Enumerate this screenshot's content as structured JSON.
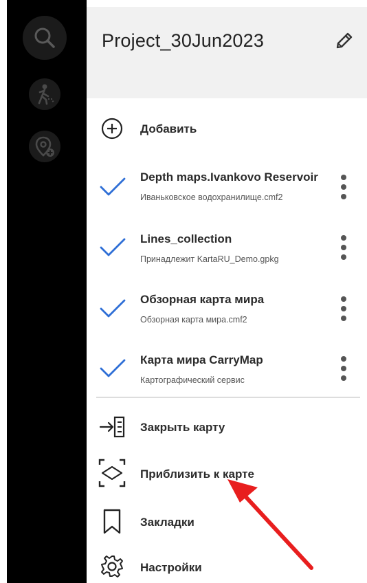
{
  "rail": {
    "buttons": [
      {
        "icon": "search-icon"
      },
      {
        "icon": "hiker-icon"
      },
      {
        "icon": "location-add-icon"
      }
    ]
  },
  "drawer": {
    "project_title": "Project_30Jun2023",
    "edit_icon": "pencil-icon",
    "add": {
      "icon": "add-circle-icon",
      "label": "Добавить"
    },
    "layers": [
      {
        "title": "Depth maps.Ivankovo Reservoir",
        "subtitle": "Иваньковское водохранилище.cmf2",
        "checked": true
      },
      {
        "title": "Lines_collection",
        "subtitle": "Принадлежит KartaRU_Demo.gpkg",
        "checked": true
      },
      {
        "title": "Обзорная карта мира",
        "subtitle": "Обзорная карта мира.cmf2",
        "checked": true
      },
      {
        "title": "Карта мира CarryMap",
        "subtitle": "Картографический сервис",
        "checked": true
      }
    ],
    "actions": [
      {
        "icon": "close-map-icon",
        "label": "Закрыть карту"
      },
      {
        "icon": "zoom-to-map-icon",
        "label": "Приблизить к карте"
      },
      {
        "icon": "bookmark-icon",
        "label": "Закладки"
      },
      {
        "icon": "settings-icon",
        "label": "Настройки"
      }
    ]
  },
  "colors": {
    "accent": "#2f6fd6",
    "annotation_arrow": "#e81e1e",
    "header_bg": "#f1f1f1"
  }
}
